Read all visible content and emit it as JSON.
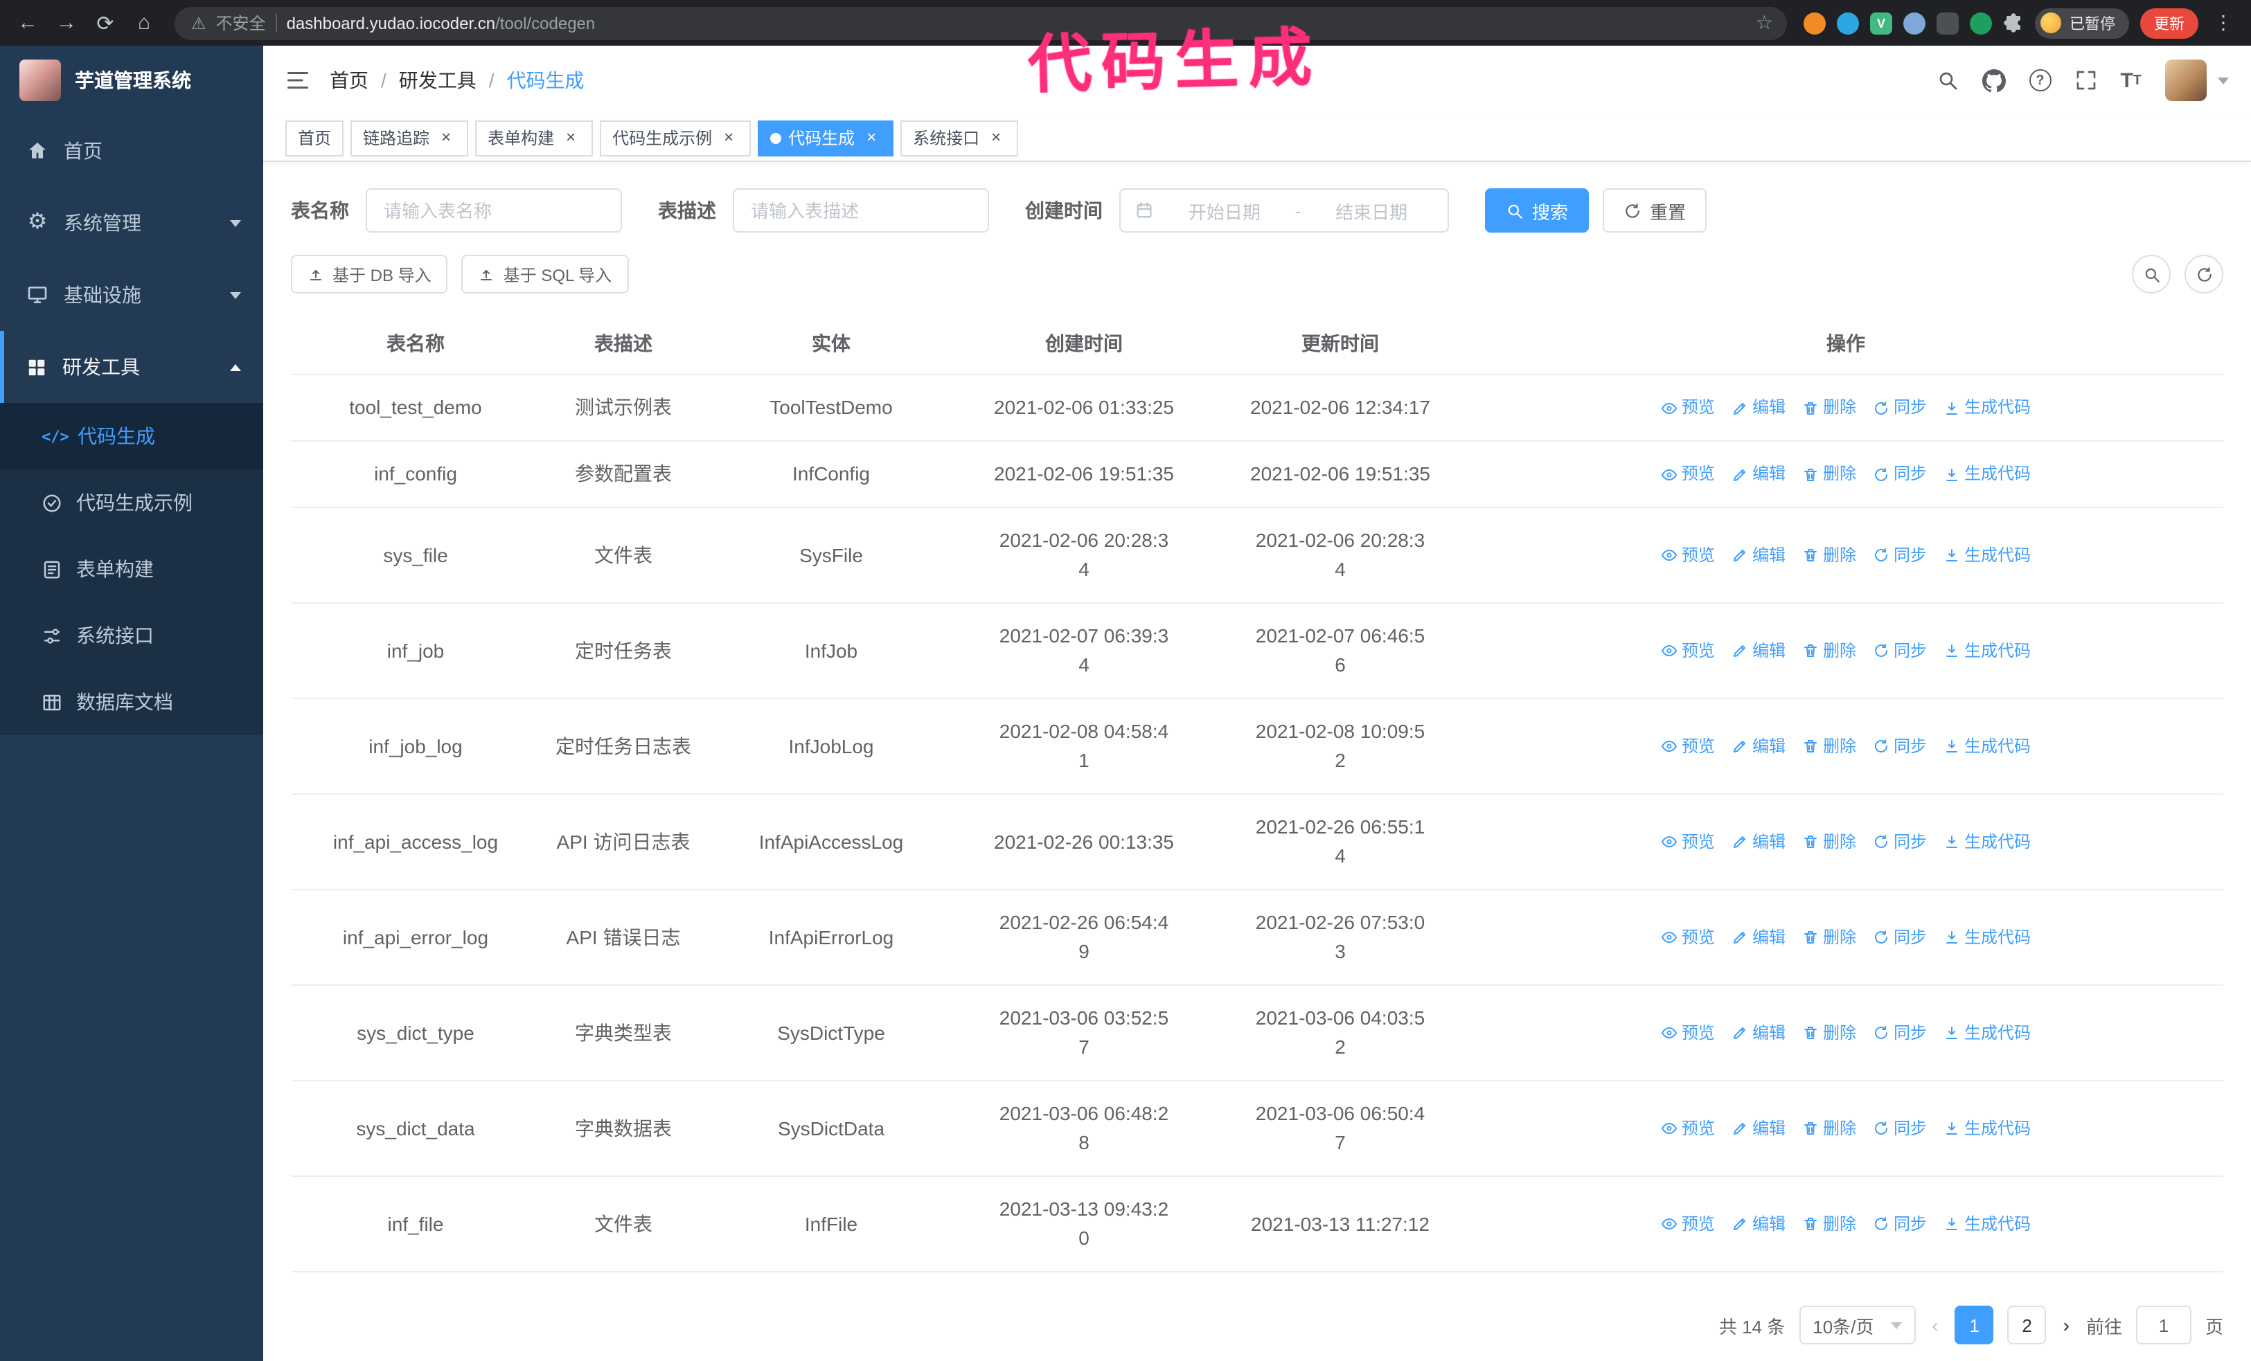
{
  "theme": {
    "primary": "#409eff",
    "sidebar_bg": "#223a54",
    "sidebar_submenu_bg": "#1b2f45",
    "annotation_color": "#ff2e7d",
    "chrome_bg": "#202124"
  },
  "browser": {
    "security_warning": "不安全",
    "url_host": "dashboard.yudao.iocoder.cn",
    "url_path": "/tool/codegen",
    "paused_badge": "已暂停",
    "update_button": "更新"
  },
  "annotation": {
    "text": "代码生成"
  },
  "sidebar": {
    "logo_title": "芋道管理系统",
    "items": [
      {
        "label": "首页"
      },
      {
        "label": "系统管理"
      },
      {
        "label": "基础设施"
      },
      {
        "label": "研发工具"
      }
    ],
    "submenu": [
      {
        "label": "代码生成",
        "active": true
      },
      {
        "label": "代码生成示例"
      },
      {
        "label": "表单构建"
      },
      {
        "label": "系统接口"
      },
      {
        "label": "数据库文档"
      }
    ]
  },
  "header": {
    "breadcrumb": [
      "首页",
      "研发工具",
      "代码生成"
    ]
  },
  "tabs": [
    {
      "label": "首页",
      "closable": false,
      "active": false
    },
    {
      "label": "链路追踪",
      "closable": true,
      "active": false
    },
    {
      "label": "表单构建",
      "closable": true,
      "active": false
    },
    {
      "label": "代码生成示例",
      "closable": true,
      "active": false
    },
    {
      "label": "代码生成",
      "closable": true,
      "active": true
    },
    {
      "label": "系统接口",
      "closable": true,
      "active": false
    }
  ],
  "filters": {
    "table_name_label": "表名称",
    "table_name_placeholder": "请输入表名称",
    "table_desc_label": "表描述",
    "table_desc_placeholder": "请输入表描述",
    "create_time_label": "创建时间",
    "date_start_placeholder": "开始日期",
    "date_separator": "-",
    "date_end_placeholder": "结束日期",
    "search_button": "搜索",
    "reset_button": "重置"
  },
  "toolbar": {
    "import_db": "基于 DB 导入",
    "import_sql": "基于 SQL 导入"
  },
  "table": {
    "columns": [
      "表名称",
      "表描述",
      "实体",
      "创建时间",
      "更新时间",
      "操作"
    ],
    "actions": [
      "预览",
      "编辑",
      "删除",
      "同步",
      "生成代码"
    ],
    "rows": [
      {
        "name": "tool_test_demo",
        "desc": "测试示例表",
        "entity": "ToolTestDemo",
        "create_time": "2021-02-06 01:33:25",
        "update_time": "2021-02-06 12:34:17"
      },
      {
        "name": "inf_config",
        "desc": "参数配置表",
        "entity": "InfConfig",
        "create_time": "2021-02-06 19:51:35",
        "update_time": "2021-02-06 19:51:35"
      },
      {
        "name": "sys_file",
        "desc": "文件表",
        "entity": "SysFile",
        "create_time": "2021-02-06 20:28:3\n4",
        "update_time": "2021-02-06 20:28:3\n4"
      },
      {
        "name": "inf_job",
        "desc": "定时任务表",
        "entity": "InfJob",
        "create_time": "2021-02-07 06:39:3\n4",
        "update_time": "2021-02-07 06:46:5\n6"
      },
      {
        "name": "inf_job_log",
        "desc": "定时任务日志表",
        "entity": "InfJobLog",
        "create_time": "2021-02-08 04:58:4\n1",
        "update_time": "2021-02-08 10:09:5\n2"
      },
      {
        "name": "inf_api_access_log",
        "desc": "API 访问日志表",
        "entity": "InfApiAccessLog",
        "create_time": "2021-02-26 00:13:35",
        "update_time": "2021-02-26 06:55:1\n4"
      },
      {
        "name": "inf_api_error_log",
        "desc": "API 错误日志",
        "entity": "InfApiErrorLog",
        "create_time": "2021-02-26 06:54:4\n9",
        "update_time": "2021-02-26 07:53:0\n3"
      },
      {
        "name": "sys_dict_type",
        "desc": "字典类型表",
        "entity": "SysDictType",
        "create_time": "2021-03-06 03:52:5\n7",
        "update_time": "2021-03-06 04:03:5\n2"
      },
      {
        "name": "sys_dict_data",
        "desc": "字典数据表",
        "entity": "SysDictData",
        "create_time": "2021-03-06 06:48:2\n8",
        "update_time": "2021-03-06 06:50:4\n7"
      },
      {
        "name": "inf_file",
        "desc": "文件表",
        "entity": "InfFile",
        "create_time": "2021-03-13 09:43:2\n0",
        "update_time": "2021-03-13 11:27:12"
      }
    ]
  },
  "pagination": {
    "total": "共 14 条",
    "page_size": "10条/页",
    "pages": [
      "1",
      "2"
    ],
    "active_page": "1",
    "goto_label": "前往",
    "goto_value": "1",
    "goto_unit": "页"
  }
}
